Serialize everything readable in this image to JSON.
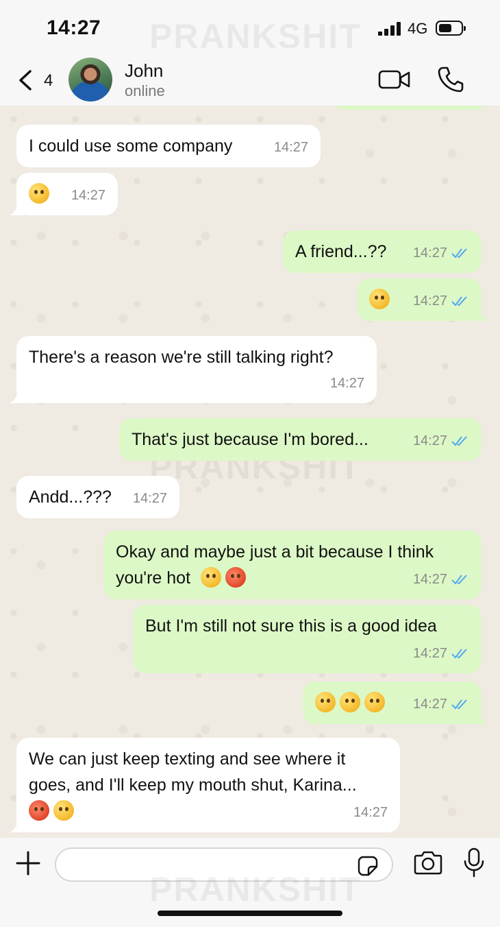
{
  "status_bar": {
    "time": "14:27",
    "network": "4G"
  },
  "watermark": "PRANKSHIT",
  "header": {
    "back_count": "4",
    "contact_name": "John",
    "contact_status": "online"
  },
  "messages": [
    {
      "dir": "in",
      "text": "I could use some company",
      "time": "14:27"
    },
    {
      "dir": "in",
      "text": "",
      "emojis": [
        "wink"
      ],
      "time": "14:27"
    },
    {
      "dir": "out",
      "text": "A friend...??",
      "time": "14:27"
    },
    {
      "dir": "out",
      "text": "",
      "emojis": [
        "flushed"
      ],
      "time": "14:27"
    },
    {
      "dir": "in",
      "text": "There's a reason we're still talking right?",
      "time": "14:27"
    },
    {
      "dir": "out",
      "text": "That's just because I'm bored...",
      "time": "14:27"
    },
    {
      "dir": "in",
      "text": "Andd...???",
      "time": "14:27"
    },
    {
      "dir": "out",
      "text": "Okay and maybe just a bit because I think you're hot",
      "emojis": [
        "hand-over-mouth",
        "hot-face"
      ],
      "time": "14:27"
    },
    {
      "dir": "out",
      "text": "But I'm still not sure this is a good idea",
      "time": "14:27"
    },
    {
      "dir": "out",
      "text": "",
      "emojis": [
        "hand-over-mouth",
        "flushed",
        "grimacing"
      ],
      "time": "14:27"
    },
    {
      "dir": "in",
      "text": "We can just keep texting and see where it goes, and I'll keep my mouth shut, Karina...",
      "emojis": [
        "kissing-heart",
        "relieved"
      ],
      "time": "14:27"
    }
  ],
  "input": {
    "placeholder": ""
  },
  "colors": {
    "incoming": "#ffffff",
    "outgoing": "#dcf8c6",
    "read_ticks": "#4fa8f0"
  }
}
